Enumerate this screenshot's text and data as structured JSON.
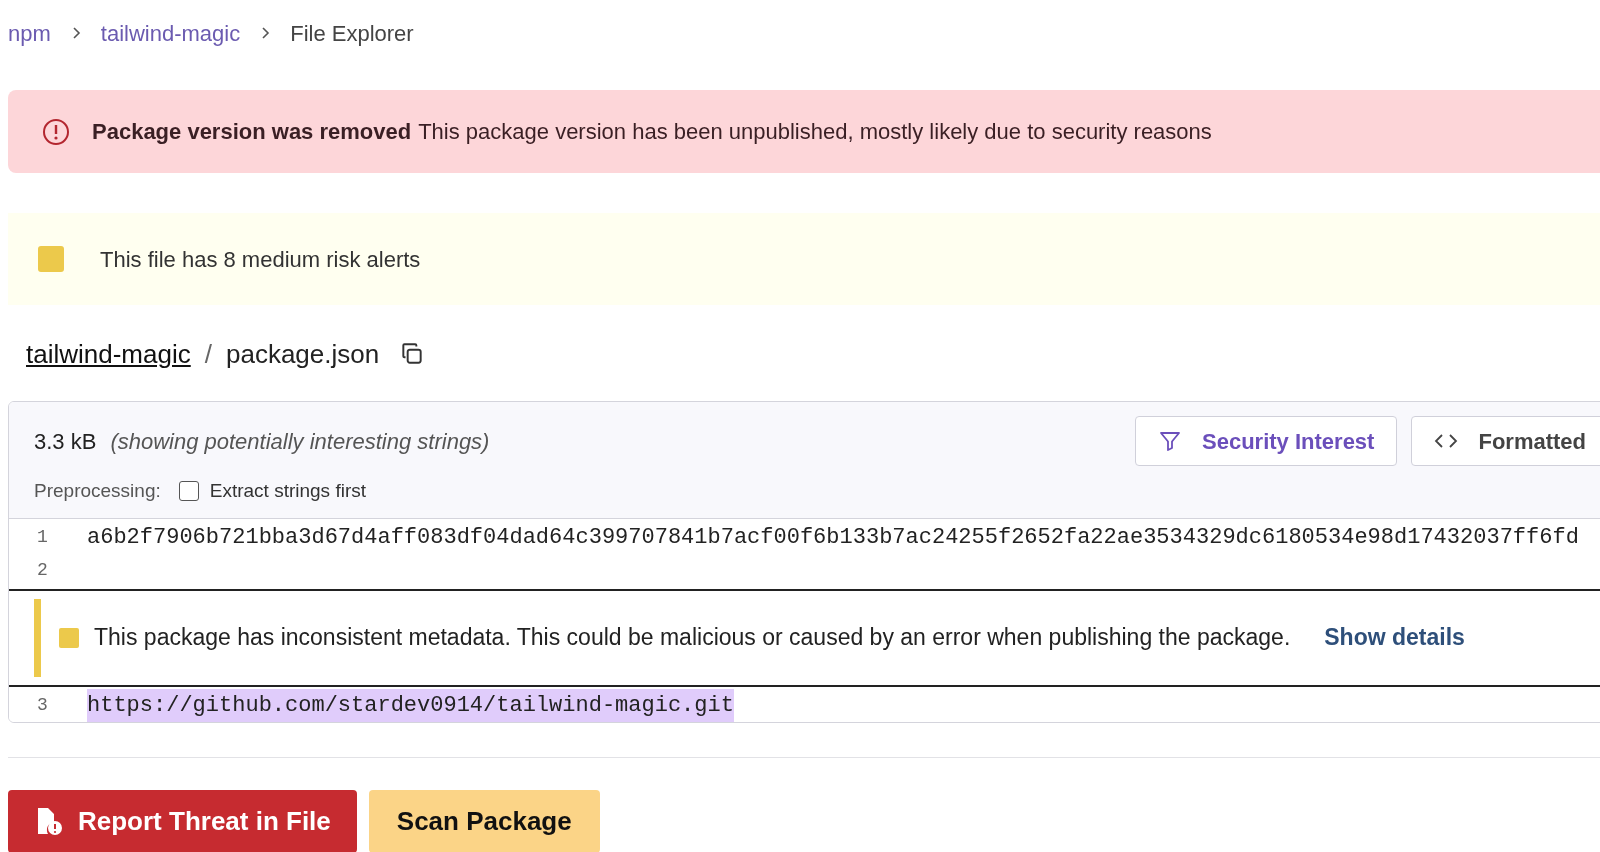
{
  "breadcrumb": [
    {
      "label": "npm",
      "link": true
    },
    {
      "label": "tailwind-magic",
      "link": true
    },
    {
      "label": "File Explorer",
      "link": false
    }
  ],
  "removed_banner": {
    "title": "Package version was removed",
    "message": "This package version has been unpublished, mostly likely due to security reasons"
  },
  "risk_banner": {
    "text": "This file has 8 medium risk alerts",
    "color": "#ecc94b"
  },
  "file_path": {
    "package": "tailwind-magic",
    "separator": "/",
    "file": "package.json"
  },
  "viewer": {
    "size": "3.3 kB",
    "note": "(showing potentially interesting strings)",
    "toggles": [
      {
        "label": "Security Interest",
        "kind": "filter",
        "selected": true
      },
      {
        "label": "Formatted",
        "kind": "code",
        "selected": false
      }
    ],
    "preprocessing": {
      "label": "Preprocessing:",
      "option": "Extract strings first",
      "checked": false
    },
    "lines": [
      {
        "kind": "code",
        "number": "1",
        "text": "a6b2f7906b721bba3d67d4aff083df04dad64c399707841b7acf00f6b133b7ac24255f2652fa22ae3534329dc6180534e98d17432037ff6fd"
      },
      {
        "kind": "code",
        "number": "2"
      },
      {
        "kind": "alert",
        "text": "This package has inconsistent metadata. This could be malicious or caused by an error when publishing the package.",
        "link": "Show details",
        "color": "#ecc94b"
      },
      {
        "kind": "code",
        "number": "3",
        "text": "https://github.com/stardev0914/tailwind-magic.git",
        "highlighted": true
      }
    ]
  },
  "actions": [
    {
      "label": "Report Threat in File",
      "kind": "danger"
    },
    {
      "label": "Scan Package",
      "kind": "warning"
    }
  ]
}
